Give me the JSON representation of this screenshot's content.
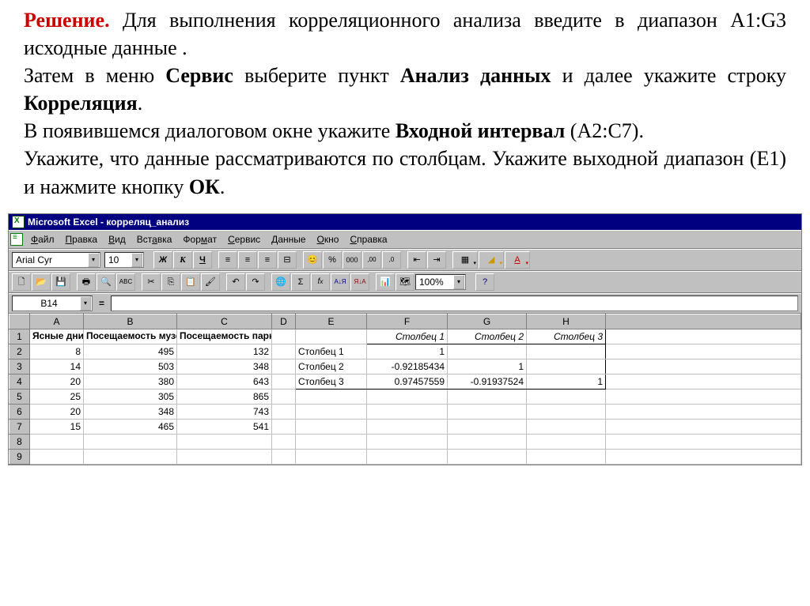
{
  "doc": {
    "solution_label": "Решение.",
    "p1_a": " Для выполнения корреляционного анализа введите в диапазон A1:G3 исходные данные .",
    "p2_a": "Затем в меню ",
    "p2_service": "Сервис",
    "p2_b": " выберите пункт ",
    "p2_analysis": "Анализ данных",
    "p2_c": " и далее укажите строку ",
    "p2_corr": "Корреляция",
    "p2_d": ".",
    "p3_a": "В появившемся диалоговом окне укажите ",
    "p3_input": "Входной интервал",
    "p3_b": " (A2:C7).",
    "p4_a": "Укажите, что данные рассматриваются по столбцам. Укажите выходной диапазон (E1) и нажмите кнопку ",
    "p4_ok": "ОК",
    "p4_b": "."
  },
  "excel": {
    "title": "Microsoft Excel - корреляц_анализ",
    "menu": [
      "Файл",
      "Правка",
      "Вид",
      "Вставка",
      "Формат",
      "Сервис",
      "Данные",
      "Окно",
      "Справка"
    ],
    "font_name": "Arial Cyr",
    "font_size": "10",
    "zoom": "100%",
    "namebox": "B14",
    "eq": "=",
    "cols": [
      "A",
      "B",
      "C",
      "D",
      "E",
      "F",
      "G",
      "H"
    ],
    "row_nums": [
      "1",
      "2",
      "3",
      "4",
      "5",
      "6",
      "7",
      "8",
      "9"
    ],
    "headers": {
      "A": "Ясные дни",
      "B": "Посещаемость музея",
      "C": "Посещаемость парка"
    },
    "corr_headers": {
      "F": "Столбец 1",
      "G": "Столбец 2",
      "H": "Столбец 3"
    },
    "data_rows": [
      {
        "A": "8",
        "B": "495",
        "C": "132",
        "E": "Столбец 1",
        "F": "1",
        "G": "",
        "H": ""
      },
      {
        "A": "14",
        "B": "503",
        "C": "348",
        "E": "Столбец 2",
        "F": "-0.92185434",
        "G": "1",
        "H": ""
      },
      {
        "A": "20",
        "B": "380",
        "C": "643",
        "E": "Столбец 3",
        "F": "0.97457559",
        "G": "-0.91937524",
        "H": "1"
      },
      {
        "A": "25",
        "B": "305",
        "C": "865",
        "E": "",
        "F": "",
        "G": "",
        "H": ""
      },
      {
        "A": "20",
        "B": "348",
        "C": "743",
        "E": "",
        "F": "",
        "G": "",
        "H": ""
      },
      {
        "A": "15",
        "B": "465",
        "C": "541",
        "E": "",
        "F": "",
        "G": "",
        "H": ""
      },
      {
        "A": "",
        "B": "",
        "C": "",
        "E": "",
        "F": "",
        "G": "",
        "H": ""
      },
      {
        "A": "",
        "B": "",
        "C": "",
        "E": "",
        "F": "",
        "G": "",
        "H": ""
      }
    ]
  },
  "chart_data": {
    "type": "table",
    "input_data": {
      "columns": [
        "Ясные дни",
        "Посещаемость музея",
        "Посещаемость парка"
      ],
      "rows": [
        [
          8,
          495,
          132
        ],
        [
          14,
          503,
          348
        ],
        [
          20,
          380,
          643
        ],
        [
          25,
          305,
          865
        ],
        [
          20,
          348,
          743
        ],
        [
          15,
          465,
          541
        ]
      ]
    },
    "correlation_matrix": {
      "labels": [
        "Столбец 1",
        "Столбец 2",
        "Столбец 3"
      ],
      "values": [
        [
          1,
          null,
          null
        ],
        [
          -0.92185434,
          1,
          null
        ],
        [
          0.97457559,
          -0.91937524,
          1
        ]
      ]
    }
  }
}
